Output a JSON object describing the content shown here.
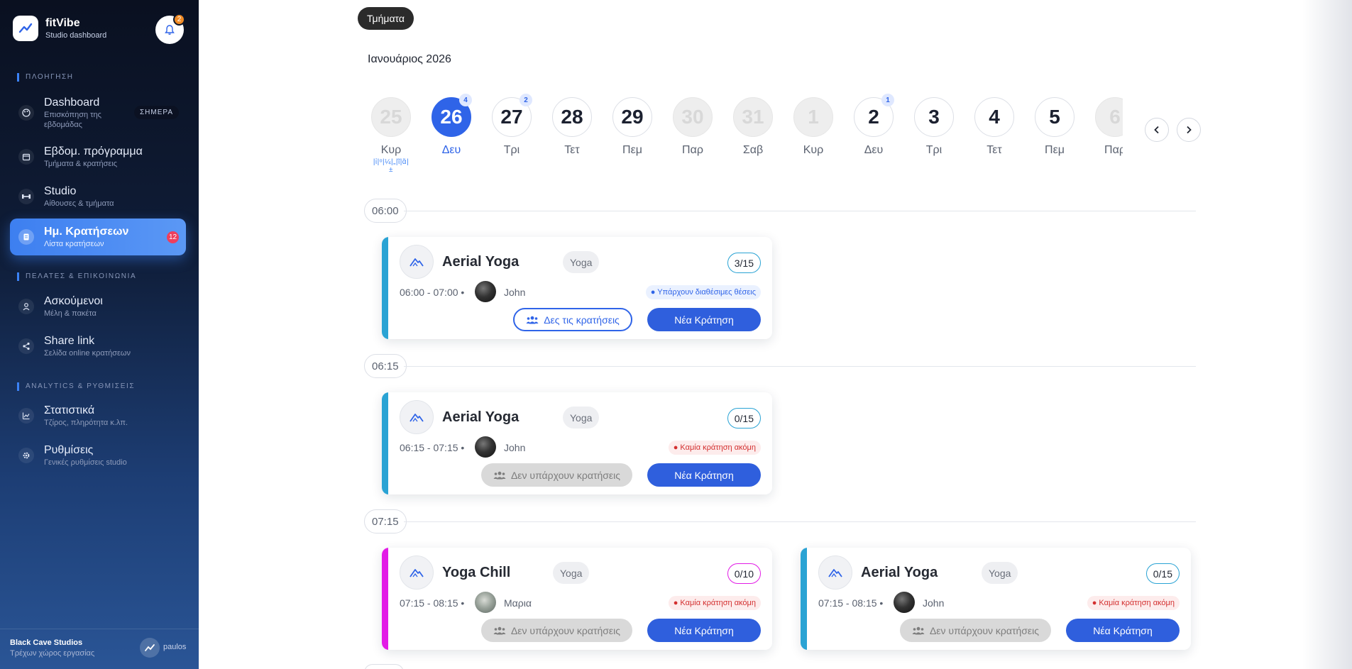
{
  "sidebar": {
    "brand": {
      "name": "fitVibe",
      "sub": "Studio dashboard"
    },
    "bell_count": "2",
    "sections": {
      "nav": "ΠΛΟΗΓΗΣΗ",
      "clients": "ΠΕΛΑΤΕΣ & ΕΠΙΚΟΙΝΩΝΙΑ",
      "analytics": "ANALYTICS & ΡΥΘΜΙΣΕΙΣ"
    },
    "items": [
      {
        "label": "Dashboard",
        "sub": "Επισκόπηση της εβδομάδας",
        "pill": "ΣΗΜΕΡΑ"
      },
      {
        "label": "Εβδομ. πρόγραμμα",
        "sub": "Τμήματα & κρατήσεις"
      },
      {
        "label": "Studio",
        "sub": "Αίθουσες & τμήματα"
      },
      {
        "label": "Ημ. Κρατήσεων",
        "sub": "Λίστα κρατήσεων",
        "badge": "12"
      },
      {
        "label": "Ασκούμενοι",
        "sub": "Μέλη & πακέτα"
      },
      {
        "label": "Share link",
        "sub": "Σελίδα online κρατήσεων"
      },
      {
        "label": "Στατιστικά",
        "sub": "Τζίρος, πληρότητα κ.λπ."
      },
      {
        "label": "Ρυθμίσεις",
        "sub": "Γενικές ρυθμίσεις studio"
      }
    ],
    "footer": {
      "studio": "Black Cave Studios",
      "sub": "Τρέχων χώρος εργασίας",
      "user": "paulos"
    }
  },
  "main": {
    "filter_tag": "Τμήματα",
    "month": "Ιανουάριος 2026",
    "days": [
      {
        "num": "25",
        "name": "Κυρ",
        "state": "muted",
        "marker": "|ἰ|ᵒ|¼|„|ῖ|ᾶ|±"
      },
      {
        "num": "26",
        "name": "Δευ",
        "state": "active",
        "badge": "4"
      },
      {
        "num": "27",
        "name": "Τρι",
        "state": "normal",
        "badge": "2"
      },
      {
        "num": "28",
        "name": "Τετ",
        "state": "normal"
      },
      {
        "num": "29",
        "name": "Πεμ",
        "state": "normal"
      },
      {
        "num": "30",
        "name": "Παρ",
        "state": "muted"
      },
      {
        "num": "31",
        "name": "Σαβ",
        "state": "muted"
      },
      {
        "num": "1",
        "name": "Κυρ",
        "state": "muted"
      },
      {
        "num": "2",
        "name": "Δευ",
        "state": "normal",
        "badge": "1"
      },
      {
        "num": "3",
        "name": "Τρι",
        "state": "normal"
      },
      {
        "num": "4",
        "name": "Τετ",
        "state": "normal"
      },
      {
        "num": "5",
        "name": "Πεμ",
        "state": "normal"
      },
      {
        "num": "6",
        "name": "Παρ",
        "state": "muted"
      }
    ],
    "time_slots": [
      "06:00",
      "06:15",
      "07:15"
    ],
    "classes": [
      {
        "title": "Aerial Yoga",
        "type": "Yoga",
        "capacity": "3/15",
        "time": "06:00 - 07:00 •",
        "trainer": "John",
        "status": "● Υπάρχουν διαθέσιμες θέσεις",
        "view_label": "Δες τις κρατήσεις",
        "new_label": "Νέα Κράτηση",
        "accent": "#2aa3d4"
      },
      {
        "title": "Aerial Yoga",
        "type": "Yoga",
        "capacity": "0/15",
        "time": "06:15 - 07:15 •",
        "trainer": "John",
        "status": "● Καμία κράτηση ακόμη",
        "view_label": "Δεν υπάρχουν κρατήσεις",
        "new_label": "Νέα Κράτηση",
        "accent": "#2aa3d4"
      },
      {
        "title": "Yoga Chill",
        "type": "Yoga",
        "capacity": "0/10",
        "time": "07:15 - 08:15 •",
        "trainer": "Μαρια",
        "status": "● Καμία κράτηση ακόμη",
        "view_label": "Δεν υπάρχουν κρατήσεις",
        "new_label": "Νέα Κράτηση",
        "accent": "#e21ce6"
      },
      {
        "title": "Aerial Yoga",
        "type": "Yoga",
        "capacity": "0/15",
        "time": "07:15 - 08:15 •",
        "trainer": "John",
        "status": "● Καμία κράτηση ακόμη",
        "view_label": "Δεν υπάρχουν κρατήσεις",
        "new_label": "Νέα Κράτηση",
        "accent": "#2aa3d4"
      }
    ]
  },
  "colors": {
    "primary": "#2f64e8",
    "aerial_accent": "#2aa3d4",
    "chill_accent": "#e21ce6",
    "danger": "#d32f2f"
  }
}
